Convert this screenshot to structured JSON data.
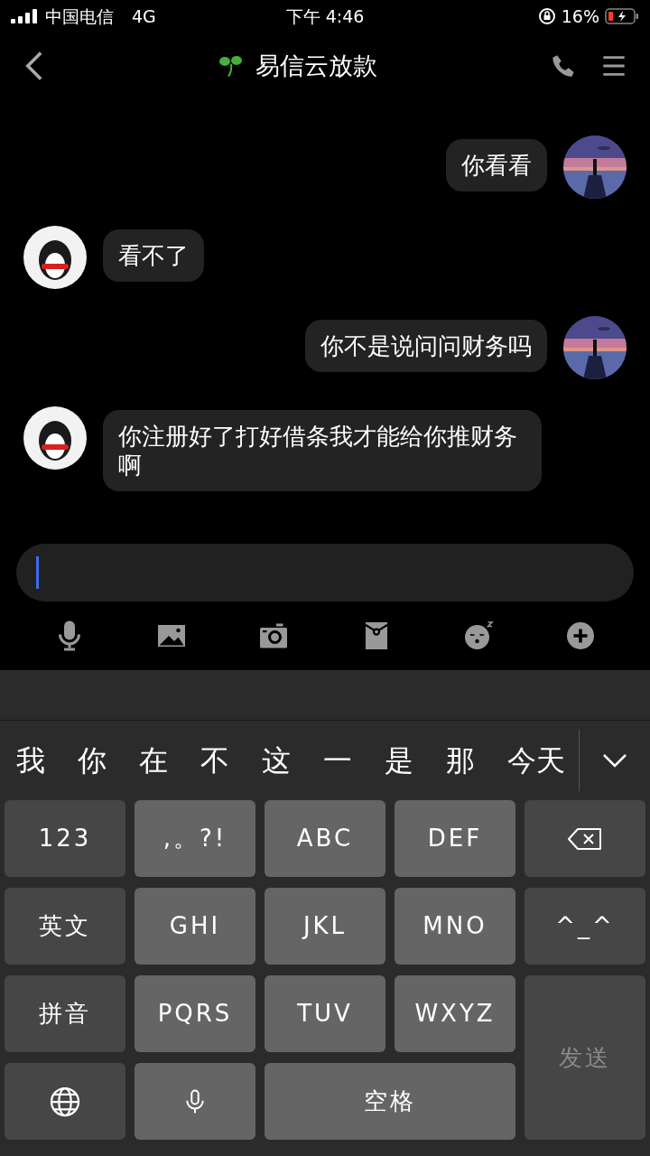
{
  "status_bar": {
    "carrier": "中国电信",
    "network": "4G",
    "time": "下午 4:46",
    "battery": "16%"
  },
  "nav": {
    "title": "易信云放款"
  },
  "messages": [
    {
      "kind": "sent",
      "text": "你看看"
    },
    {
      "kind": "received",
      "text": "看不了"
    },
    {
      "kind": "sent",
      "text": "你不是说问问财务吗"
    },
    {
      "kind": "received",
      "text": "你注册好了打好借条我才能给你推财务啊"
    }
  ],
  "candidates": [
    "我",
    "你",
    "在",
    "不",
    "这",
    "一",
    "是",
    "那",
    "今天"
  ],
  "keys": [
    {
      "kind": "function",
      "label": "123"
    },
    {
      "kind": "letter",
      "label": ",。?!"
    },
    {
      "kind": "letter",
      "label": "ABC"
    },
    {
      "kind": "letter",
      "label": "DEF"
    },
    {
      "kind": "backspace"
    },
    {
      "kind": "function",
      "label": "英文"
    },
    {
      "kind": "letter",
      "label": "GHI"
    },
    {
      "kind": "letter",
      "label": "JKL"
    },
    {
      "kind": "letter",
      "label": "MNO"
    },
    {
      "kind": "function",
      "label": "^_^"
    },
    {
      "kind": "function",
      "label": "拼音"
    },
    {
      "kind": "letter",
      "label": "PQRS"
    },
    {
      "kind": "letter",
      "label": "TUV"
    },
    {
      "kind": "letter",
      "label": "WXYZ"
    },
    {
      "kind": "send",
      "label": "发送",
      "disabled": true
    },
    {
      "kind": "globe"
    },
    {
      "kind": "mic"
    },
    {
      "kind": "space",
      "label": "空格"
    }
  ]
}
